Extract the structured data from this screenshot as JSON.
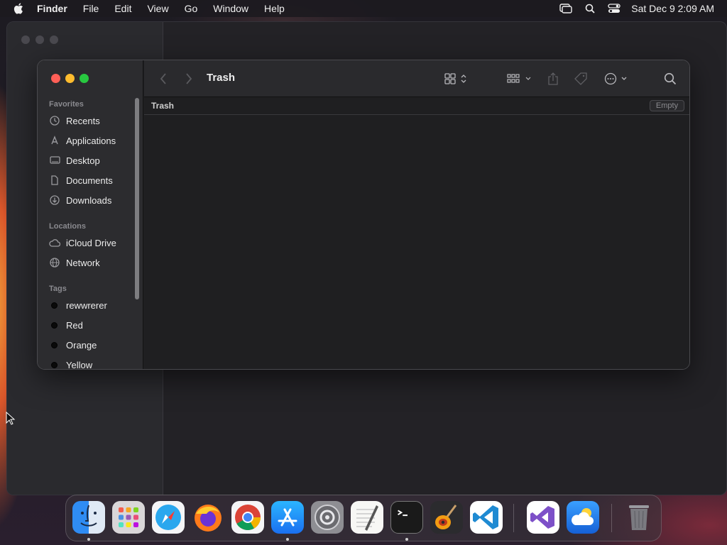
{
  "menubar": {
    "app_name": "Finder",
    "items": [
      "File",
      "Edit",
      "View",
      "Go",
      "Window",
      "Help"
    ],
    "clock": "Sat Dec 9  2:09 AM",
    "status_icons": [
      "screen-mirroring-icon",
      "spotlight-search-icon",
      "control-center-icon"
    ]
  },
  "finder": {
    "title": "Trash",
    "path_label": "Trash",
    "empty_button": "Empty",
    "sidebar": {
      "favorites_header": "Favorites",
      "favorites": [
        {
          "label": "Recents",
          "icon": "clock-icon"
        },
        {
          "label": "Applications",
          "icon": "applications-icon"
        },
        {
          "label": "Desktop",
          "icon": "desktop-icon"
        },
        {
          "label": "Documents",
          "icon": "document-icon"
        },
        {
          "label": "Downloads",
          "icon": "download-icon"
        }
      ],
      "locations_header": "Locations",
      "locations": [
        {
          "label": "iCloud Drive",
          "icon": "cloud-icon"
        },
        {
          "label": "Network",
          "icon": "network-icon"
        }
      ],
      "tags_header": "Tags",
      "tags": [
        {
          "label": "rewwrerer",
          "color": "#0a0a0a"
        },
        {
          "label": "Red",
          "color": "#0a0a0a"
        },
        {
          "label": "Orange",
          "color": "#0a0a0a"
        },
        {
          "label": "Yellow",
          "color": "#0a0a0a"
        }
      ]
    }
  },
  "dock": {
    "apps": [
      "Finder",
      "Launchpad",
      "Safari",
      "Firefox",
      "Chrome",
      "App Store",
      "System Settings",
      "TextEdit",
      "Terminal",
      "GarageBand",
      "Visual Studio Code",
      "Visual Studio",
      "Weather",
      "Trash"
    ]
  },
  "colors": {
    "close": "#ff5f57",
    "minimize": "#febc2e",
    "maximize": "#28c840",
    "window_bg": "#1f1f21",
    "sidebar_bg": "#2c2c2f"
  }
}
